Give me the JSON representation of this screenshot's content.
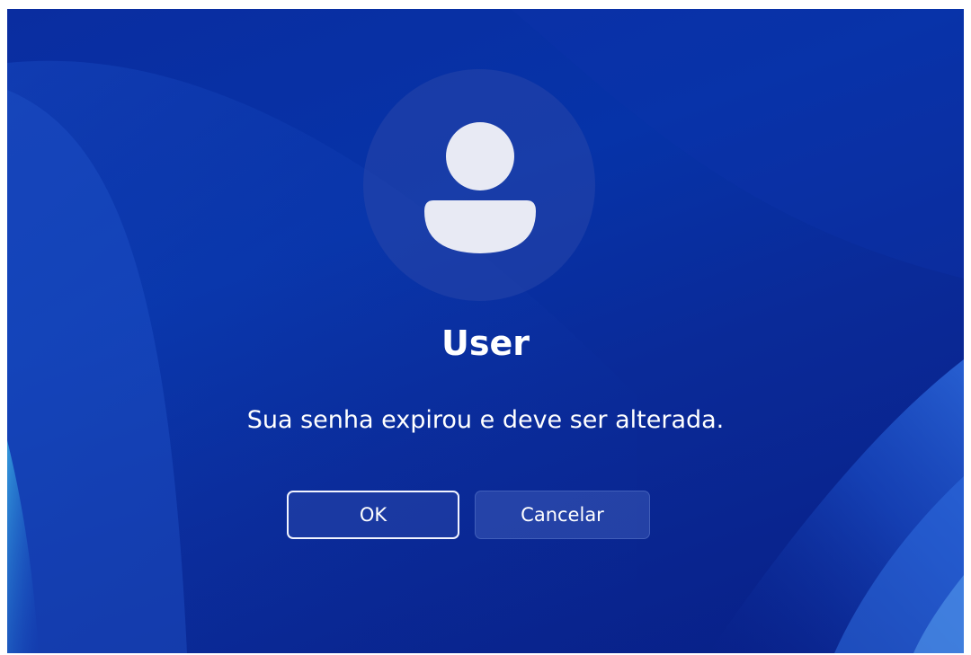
{
  "dialog": {
    "username": "User",
    "message": "Sua senha expirou e deve ser alterada.",
    "ok_label": "OK",
    "cancel_label": "Cancelar",
    "avatar_icon": "user-silhouette-icon"
  },
  "colors": {
    "background": "#0a2da0",
    "text": "#ffffff",
    "avatar_fill": "#e8eaf4"
  }
}
